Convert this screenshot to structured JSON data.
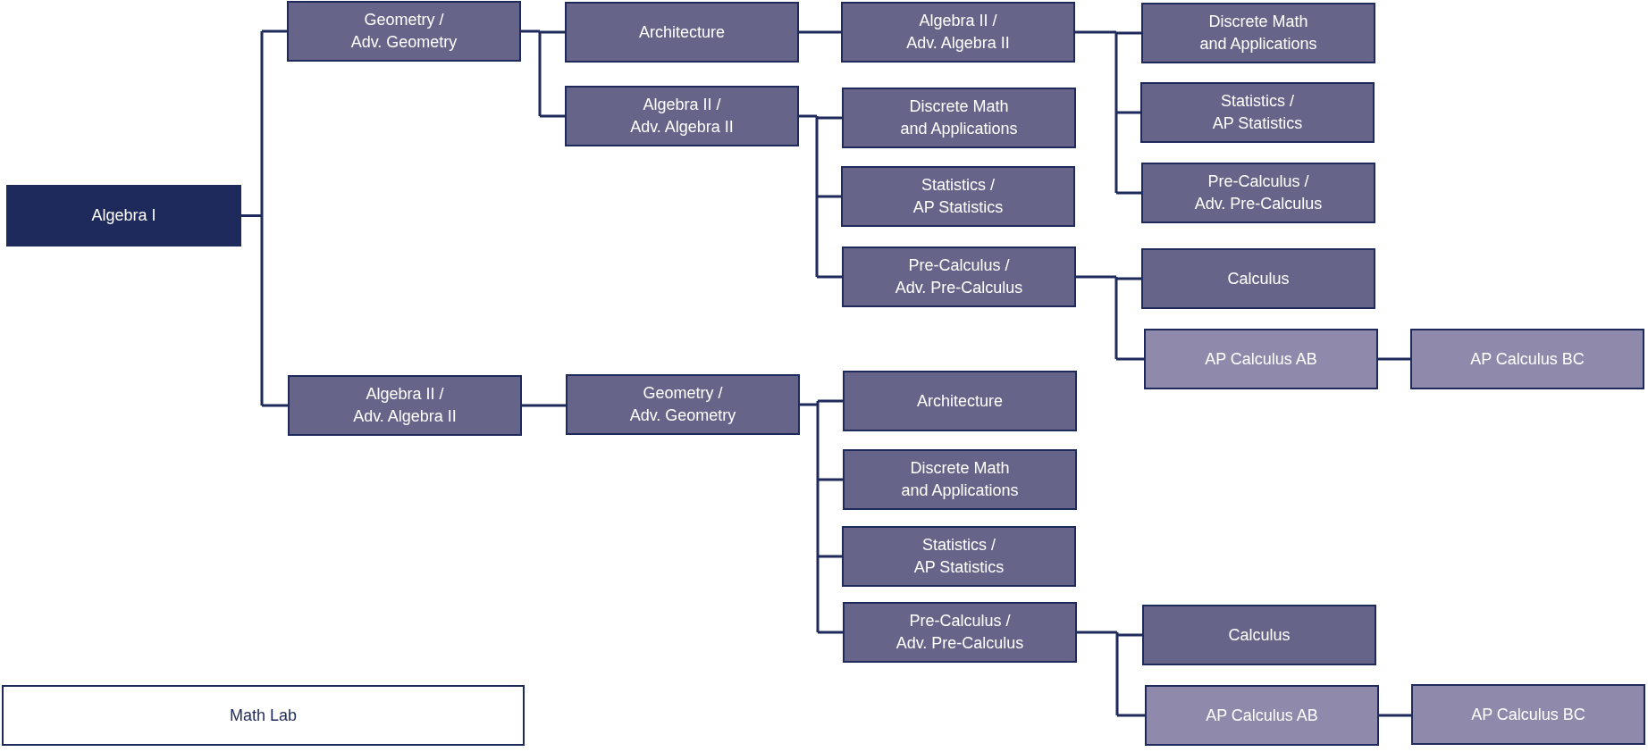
{
  "tree": {
    "label": "Algebra I",
    "kind": "root",
    "children": [
      {
        "label": "Geometry /\nAdv. Geometry",
        "kind": "course",
        "children": [
          {
            "label": "Architecture",
            "kind": "course",
            "children": [
              {
                "label": "Algebra II /\nAdv. Algebra II",
                "kind": "course",
                "children": [
                  {
                    "label": "Discrete Math\nand Applications",
                    "kind": "course"
                  },
                  {
                    "label": "Statistics /\nAP Statistics",
                    "kind": "course"
                  },
                  {
                    "label": "Pre-Calculus /\nAdv. Pre-Calculus",
                    "kind": "course"
                  }
                ]
              }
            ]
          },
          {
            "label": "Algebra II /\nAdv. Algebra II",
            "kind": "course",
            "children": [
              {
                "label": "Discrete Math\nand Applications",
                "kind": "course"
              },
              {
                "label": "Statistics /\nAP Statistics",
                "kind": "course"
              },
              {
                "label": "Pre-Calculus /\nAdv. Pre-Calculus",
                "kind": "course",
                "children": [
                  {
                    "label": "Calculus",
                    "kind": "course"
                  },
                  {
                    "label": "AP Calculus AB",
                    "kind": "ap",
                    "children": [
                      {
                        "label": "AP Calculus BC",
                        "kind": "ap"
                      }
                    ]
                  }
                ]
              }
            ]
          }
        ]
      },
      {
        "label": "Algebra II /\nAdv. Algebra II",
        "kind": "course",
        "children": [
          {
            "label": "Geometry /\nAdv. Geometry",
            "kind": "course",
            "children": [
              {
                "label": "Architecture",
                "kind": "course"
              },
              {
                "label": "Discrete Math\nand Applications",
                "kind": "course"
              },
              {
                "label": "Statistics /\nAP Statistics",
                "kind": "course"
              },
              {
                "label": "Pre-Calculus /\nAdv. Pre-Calculus",
                "kind": "course",
                "children": [
                  {
                    "label": "Calculus",
                    "kind": "course"
                  },
                  {
                    "label": "AP Calculus AB",
                    "kind": "ap",
                    "children": [
                      {
                        "label": "AP Calculus BC",
                        "kind": "ap"
                      }
                    ]
                  }
                ]
              }
            ]
          }
        ]
      }
    ]
  },
  "extra": [
    {
      "label": "Math Lab",
      "kind": "lab"
    }
  ]
}
